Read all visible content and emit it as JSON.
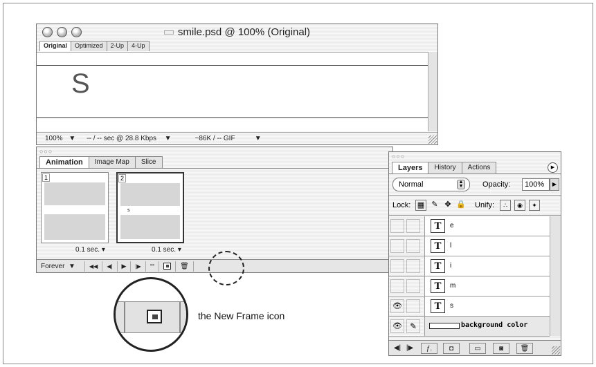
{
  "document": {
    "title": "smile.psd @ 100% (Original)",
    "tabs": [
      "Original",
      "Optimized",
      "2-Up",
      "4-Up"
    ],
    "canvas_text": "S",
    "status": {
      "zoom": "100%",
      "download_time": "-- / -- sec @ 28.8 Kbps",
      "file_info": "~86K / -- GIF"
    }
  },
  "animation_palette": {
    "tabs": [
      "Animation",
      "Image Map",
      "Slice"
    ],
    "frames": [
      {
        "number": "1",
        "delay": "0.1 sec.",
        "thumb_text": ""
      },
      {
        "number": "2",
        "delay": "0.1 sec.",
        "thumb_text": "s"
      }
    ],
    "loop": "Forever",
    "controls": {
      "first": "◀◀",
      "prev": "◀|",
      "play": "▶",
      "next": "|▶"
    }
  },
  "layers_palette": {
    "tabs": [
      "Layers",
      "History",
      "Actions"
    ],
    "blend_mode": "Normal",
    "opacity_label": "Opacity:",
    "opacity_value": "100%",
    "lock_label": "Lock:",
    "unify_label": "Unify:",
    "layers": [
      {
        "name": "e",
        "visible": false
      },
      {
        "name": "l",
        "visible": false
      },
      {
        "name": "i",
        "visible": false
      },
      {
        "name": "m",
        "visible": false
      },
      {
        "name": "s",
        "visible": true
      },
      {
        "name": "background color",
        "visible": true,
        "is_fill": true
      }
    ]
  },
  "callout": {
    "label": "the New Frame icon",
    "icon": "new-frame-icon"
  }
}
